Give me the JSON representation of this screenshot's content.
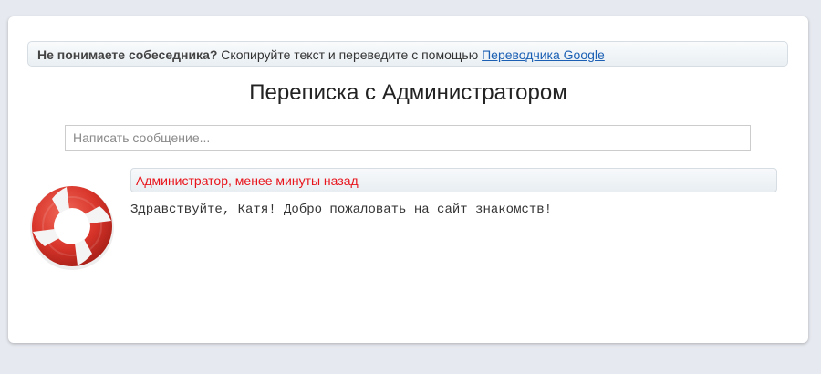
{
  "notice": {
    "bold": "Не понимаете собеседника?",
    "text": "Скопируйте текст и переведите с помощью",
    "link": "Переводчика Google"
  },
  "page": {
    "title": "Переписка с Администратором"
  },
  "compose": {
    "placeholder": "Написать сообщение..."
  },
  "message": {
    "avatar_icon": "lifebuoy-icon",
    "header": "Администратор, менее минуты назад",
    "text": "Здравствуйте, Катя! Добро пожаловать на сайт знакомств!"
  },
  "colors": {
    "author": "#e8141c",
    "link": "#1a5fb4"
  }
}
